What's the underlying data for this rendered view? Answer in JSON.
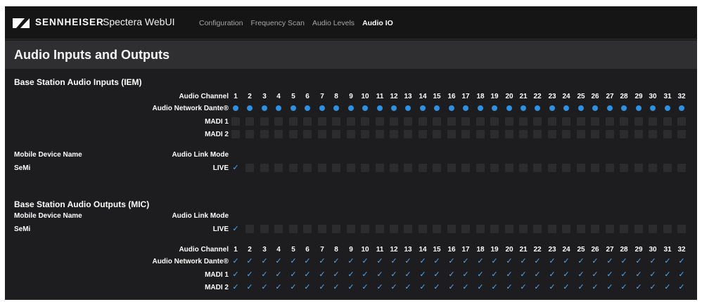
{
  "topbar": {
    "brand": "SENNHEISER",
    "app_title": "Spectera WebUI",
    "nav": [
      "Configuration",
      "Frequency Scan",
      "Audio Levels",
      "Audio IO"
    ],
    "active_nav": "Audio IO"
  },
  "page": {
    "title": "Audio Inputs and Outputs"
  },
  "inputs": {
    "title": "Base Station Audio Inputs (IEM)",
    "audio_channel_label": "Audio Channel",
    "channels": [
      "1",
      "2",
      "3",
      "4",
      "5",
      "6",
      "7",
      "8",
      "9",
      "10",
      "11",
      "12",
      "13",
      "14",
      "15",
      "16",
      "17",
      "18",
      "19",
      "20",
      "21",
      "22",
      "23",
      "24",
      "25",
      "26",
      "27",
      "28",
      "29",
      "30",
      "31",
      "32"
    ],
    "rows": [
      {
        "label": "Audio Network Dante®",
        "state": "dot"
      },
      {
        "label": "MADI 1",
        "state": "empty"
      },
      {
        "label": "MADI 2",
        "state": "empty"
      }
    ],
    "device_header": "Mobile Device Name",
    "link_mode_header": "Audio Link Mode",
    "device_name": "SeMi",
    "link_mode": "LIVE",
    "link_checked_channels": [
      1
    ]
  },
  "outputs": {
    "title": "Base Station Audio Outputs (MIC)",
    "device_header": "Mobile Device Name",
    "link_mode_header": "Audio Link Mode",
    "device_name": "SeMi",
    "link_mode": "LIVE",
    "link_checked_channels": [
      1
    ],
    "audio_channel_label": "Audio Channel",
    "rows": [
      {
        "label": "Audio Network Dante®",
        "state": "check"
      },
      {
        "label": "MADI 1",
        "state": "check"
      },
      {
        "label": "MADI 2",
        "state": "check"
      }
    ]
  },
  "colors": {
    "accent": "#2f8fe0",
    "check": "#58a8ee",
    "box": "#2c2c2f",
    "background": "#1d1d1f"
  }
}
